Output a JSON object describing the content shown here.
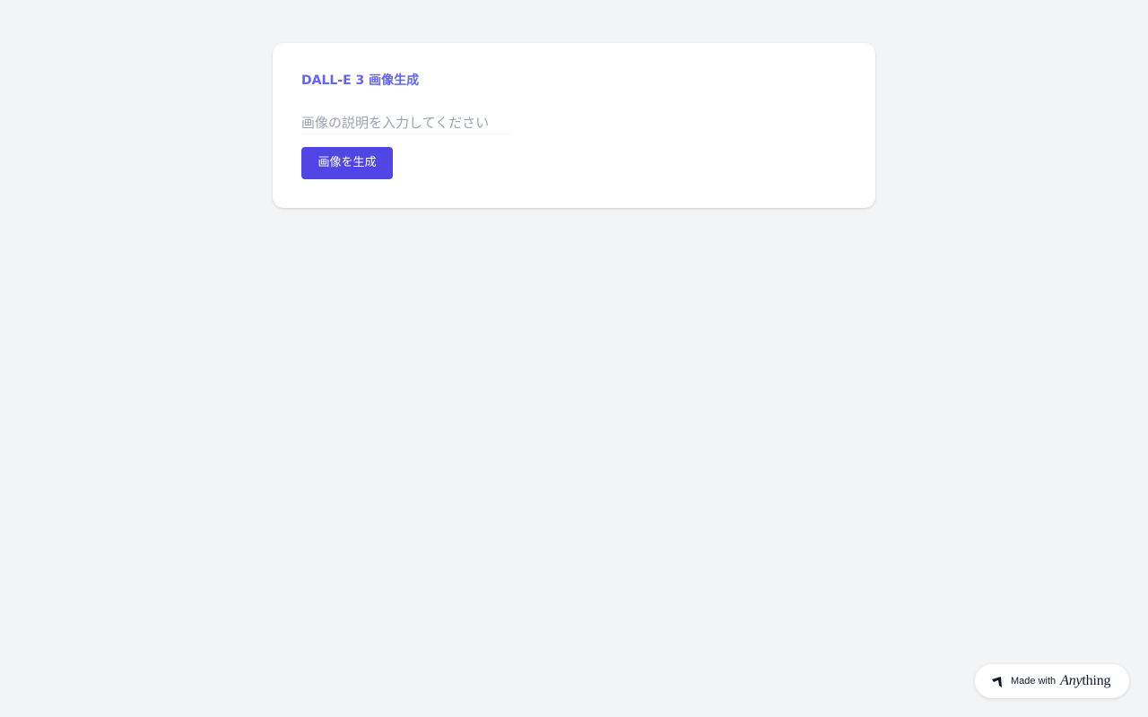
{
  "card": {
    "title": "DALL-E 3 画像生成",
    "prompt_input": {
      "value": "",
      "placeholder": "画像の説明を入力してください"
    },
    "generate_button_label": "画像を生成"
  },
  "badge": {
    "made_with": "Made with",
    "brand_italic": "Any",
    "brand_rest": "thing",
    "icon": "anything-logo-icon"
  },
  "colors": {
    "background": "#f3f4f6",
    "accent": "#6366f1",
    "button": "#4f46e5"
  }
}
